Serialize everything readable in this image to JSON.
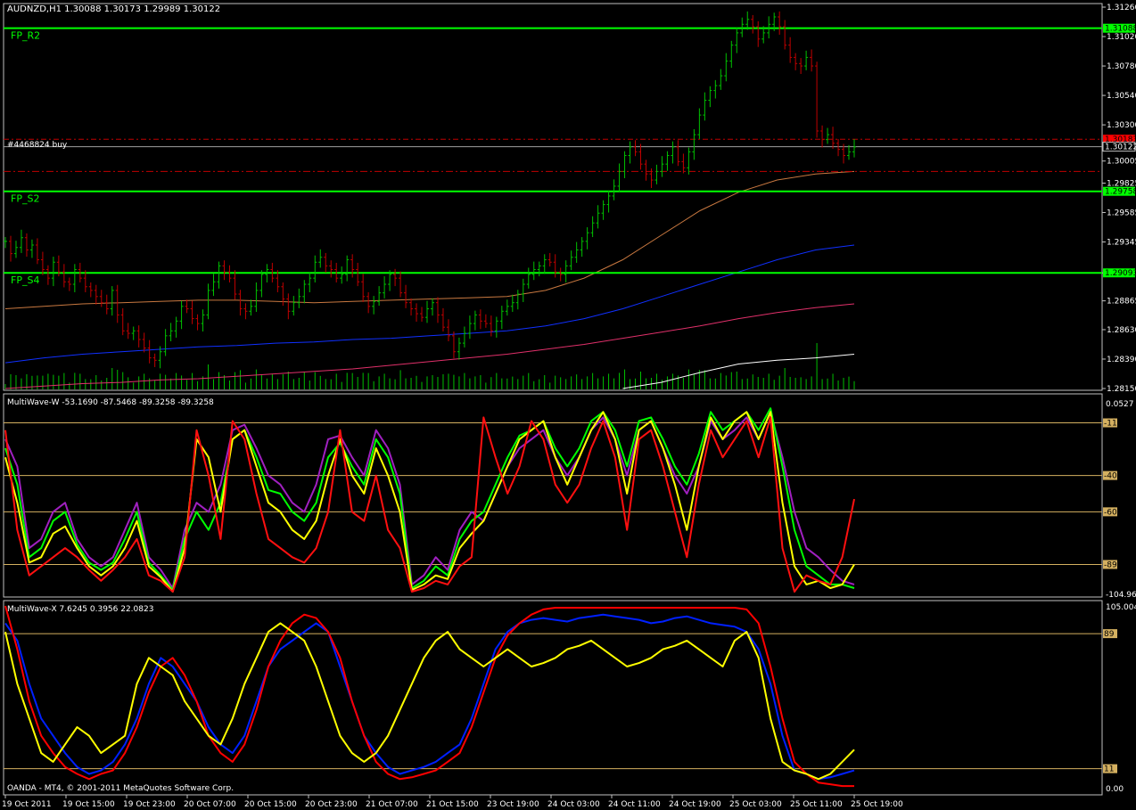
{
  "header": {
    "main_label": "AUDNZD,H1  1.30088 1.30173 1.29989 1.30122",
    "w_label": "MultiWave-W -53.1690 -87.5468 -89.3258 -89.3258",
    "x_label": "MultiWave-X 7.6245 0.3956 22.0823",
    "copyright": "OANDA - MT4, © 2001-2011 MetaQuotes Software Corp.",
    "order_label": "#4468824 buy"
  },
  "colors": {
    "background": "#000000",
    "grid": "#c0c0c0",
    "bull": "#00c000",
    "bear": "#c00000",
    "pivot": "#00ff00",
    "ma_orange": "#c87840",
    "ma_blue": "#1030ff",
    "ma_pink": "#e0306a",
    "ma_white": "#ffffff",
    "volume": "#00c000",
    "level": "#d4b060",
    "w_green": "#00ff00",
    "w_red": "#ff1010",
    "w_yellow": "#ffff00",
    "w_purple": "#a020c0",
    "x_blue": "#0020ff",
    "x_red": "#ff0000",
    "x_yellow": "#ffff00"
  },
  "chart_data": [
    {
      "type": "candlestick",
      "title": "AUDNZD,H1",
      "ylim": [
        1.2815,
        1.3126
      ],
      "y_ticks": [
        "1.31260",
        "1.31020",
        "1.30780",
        "1.30540",
        "1.30300",
        "1.30005",
        "1.29825",
        "1.29585",
        "1.29345",
        "1.29093",
        "1.28865",
        "1.28630",
        "1.28390",
        "1.28150"
      ],
      "y_tick_values": [
        1.3126,
        1.3102,
        1.3078,
        1.3054,
        1.303,
        1.30005,
        1.29825,
        1.29585,
        1.29345,
        1.29093,
        1.28865,
        1.2863,
        1.2839,
        1.2815
      ],
      "price_tags": [
        {
          "text": "1.31088",
          "value": 1.31088,
          "style": "pivot"
        },
        {
          "text": "1.30183",
          "value": 1.30183,
          "style": "order"
        },
        {
          "text": "1.30122",
          "value": 1.30122,
          "style": "current"
        },
        {
          "text": "1.29758",
          "value": 1.29758,
          "style": "pivot"
        },
        {
          "text": "1.29093",
          "value": 1.29093,
          "style": "pivot"
        }
      ],
      "pivots": [
        {
          "name": "FP_R2",
          "value": 1.31088
        },
        {
          "name": "FP_S2",
          "value": 1.29758
        },
        {
          "name": "FP_S4",
          "value": 1.29093
        }
      ],
      "order_line": 1.30183,
      "current_price": 1.30122,
      "stop_line": 1.2992,
      "closes": [
        1.2935,
        1.2925,
        1.293,
        1.2938,
        1.2928,
        1.2932,
        1.292,
        1.2912,
        1.2905,
        1.2918,
        1.291,
        1.2902,
        1.29,
        1.2912,
        1.2905,
        1.2898,
        1.2895,
        1.289,
        1.2885,
        1.288,
        1.2895,
        1.2875,
        1.2862,
        1.286,
        1.2862,
        1.2855,
        1.2848,
        1.284,
        1.2838,
        1.2845,
        1.2858,
        1.2862,
        1.287,
        1.2882,
        1.288,
        1.2872,
        1.2868,
        1.2875,
        1.2895,
        1.2902,
        1.2915,
        1.291,
        1.2905,
        1.2892,
        1.288,
        1.2878,
        1.2882,
        1.2895,
        1.2908,
        1.2912,
        1.2905,
        1.2898,
        1.2888,
        1.2878,
        1.2885,
        1.289,
        1.29,
        1.2905,
        1.2918,
        1.2922,
        1.2915,
        1.2912,
        1.2905,
        1.2908,
        1.292,
        1.2912,
        1.2902,
        1.289,
        1.2882,
        1.2886,
        1.2893,
        1.29,
        1.2908,
        1.2905,
        1.2893,
        1.2885,
        1.288,
        1.2876,
        1.2873,
        1.288,
        1.2885,
        1.2875,
        1.2865,
        1.2858,
        1.2845,
        1.2852,
        1.286,
        1.2868,
        1.2875,
        1.287,
        1.2868,
        1.2862,
        1.287,
        1.2878,
        1.2882,
        1.2885,
        1.2892,
        1.29,
        1.2908,
        1.2912,
        1.2915,
        1.292,
        1.2918,
        1.291,
        1.2908,
        1.2915,
        1.2922,
        1.2928,
        1.2935,
        1.2942,
        1.295,
        1.2958,
        1.2965,
        1.2972,
        1.298,
        1.2992,
        1.3005,
        1.3012,
        1.3008,
        1.2998,
        1.299,
        1.2985,
        1.2992,
        1.2998,
        1.3005,
        1.3012,
        1.3,
        1.2995,
        1.3008,
        1.3022,
        1.3038,
        1.305,
        1.3058,
        1.3062,
        1.307,
        1.3082,
        1.3095,
        1.3105,
        1.3112,
        1.3116,
        1.311,
        1.31,
        1.3105,
        1.3112,
        1.3118,
        1.311,
        1.3095,
        1.3085,
        1.308,
        1.3078,
        1.3085,
        1.3078,
        1.3025,
        1.3018,
        1.3022,
        1.3015,
        1.301,
        1.3005,
        1.3008,
        1.3012
      ],
      "moving_averages": [
        {
          "color": "ma_orange",
          "values": [
            1.288,
            1.2882,
            1.2884,
            1.2885,
            1.2886,
            1.2887,
            1.2887,
            1.2886,
            1.2885,
            1.2886,
            1.2887,
            1.2888,
            1.2889,
            1.289,
            1.2895,
            1.2905,
            1.292,
            1.294,
            1.296,
            1.2975,
            1.2985,
            1.299,
            1.2992
          ]
        },
        {
          "color": "ma_blue",
          "values": [
            1.2836,
            1.284,
            1.2843,
            1.2845,
            1.2847,
            1.2849,
            1.285,
            1.2852,
            1.2853,
            1.2855,
            1.2856,
            1.2858,
            1.286,
            1.2862,
            1.2866,
            1.2872,
            1.288,
            1.289,
            1.29,
            1.291,
            1.292,
            1.2928,
            1.2932
          ]
        },
        {
          "color": "ma_pink",
          "values": [
            1.2815,
            1.2817,
            1.2819,
            1.282,
            1.2822,
            1.2823,
            1.2825,
            1.2827,
            1.2829,
            1.2831,
            1.2834,
            1.2837,
            1.284,
            1.2843,
            1.2847,
            1.2851,
            1.2856,
            1.2861,
            1.2866,
            1.2872,
            1.2877,
            1.2881,
            1.2884
          ]
        },
        {
          "color": "ma_white",
          "values": [
            null,
            null,
            null,
            null,
            null,
            null,
            null,
            null,
            null,
            null,
            null,
            null,
            null,
            null,
            null,
            null,
            1.2815,
            1.282,
            1.2828,
            1.2835,
            1.2838,
            1.284,
            1.2843
          ]
        }
      ]
    },
    {
      "type": "line",
      "title": "MultiWave-W",
      "ylim": [
        -104.969,
        0.0527
      ],
      "y_ticks": [
        "0.0527",
        "-11",
        "-40",
        "-60",
        "-89",
        "-104.969"
      ],
      "y_tick_values": [
        0.0527,
        -11,
        -40,
        -60,
        -89,
        -104.969
      ],
      "levels": [
        -11,
        -40,
        -60,
        -89
      ],
      "series": [
        {
          "color": "w_purple",
          "values": [
            -20,
            -35,
            -80,
            -75,
            -60,
            -55,
            -75,
            -85,
            -90,
            -85,
            -70,
            -55,
            -85,
            -92,
            -102,
            -70,
            -55,
            -60,
            -45,
            -15,
            -12,
            -25,
            -40,
            -45,
            -55,
            -60,
            -45,
            -20,
            -18,
            -30,
            -40,
            -15,
            -25,
            -45,
            -100,
            -95,
            -85,
            -92,
            -70,
            -60,
            -65,
            -50,
            -35,
            -25,
            -20,
            -15,
            -30,
            -40,
            -30,
            -15,
            -8,
            -20,
            -40,
            -15,
            -10,
            -25,
            -40,
            -50,
            -35,
            -10,
            -20,
            -15,
            -8,
            -20,
            -5,
            -30,
            -60,
            -80,
            -85,
            -92,
            -98,
            -100
          ]
        },
        {
          "color": "w_green",
          "values": [
            -25,
            -45,
            -85,
            -80,
            -65,
            -60,
            -78,
            -88,
            -92,
            -88,
            -75,
            -60,
            -88,
            -95,
            -103,
            -75,
            -60,
            -70,
            -55,
            -20,
            -15,
            -30,
            -48,
            -50,
            -60,
            -65,
            -55,
            -30,
            -22,
            -35,
            -45,
            -20,
            -30,
            -50,
            -102,
            -98,
            -90,
            -95,
            -75,
            -65,
            -60,
            -45,
            -30,
            -18,
            -15,
            -10,
            -25,
            -35,
            -25,
            -10,
            -5,
            -15,
            -35,
            -10,
            -8,
            -20,
            -35,
            -45,
            -28,
            -5,
            -15,
            -10,
            -5,
            -15,
            -3,
            -35,
            -70,
            -90,
            -95,
            -100,
            -100,
            -102
          ]
        },
        {
          "color": "w_yellow",
          "values": [
            -30,
            -55,
            -88,
            -85,
            -72,
            -68,
            -80,
            -90,
            -95,
            -90,
            -80,
            -65,
            -90,
            -96,
            -104,
            -80,
            -20,
            -30,
            -60,
            -20,
            -15,
            -35,
            -55,
            -60,
            -70,
            -75,
            -65,
            -40,
            -20,
            -40,
            -50,
            -25,
            -40,
            -60,
            -103,
            -100,
            -95,
            -97,
            -80,
            -72,
            -65,
            -50,
            -35,
            -20,
            -15,
            -10,
            -30,
            -45,
            -30,
            -15,
            -5,
            -20,
            -50,
            -15,
            -10,
            -25,
            -45,
            -70,
            -35,
            -8,
            -20,
            -10,
            -5,
            -20,
            -5,
            -55,
            -90,
            -100,
            -98,
            -102,
            -100,
            -89
          ]
        },
        {
          "color": "w_red",
          "values": [
            -15,
            -70,
            -95,
            -90,
            -85,
            -80,
            -85,
            -92,
            -98,
            -92,
            -85,
            -75,
            -95,
            -98,
            -104,
            -85,
            -15,
            -40,
            -75,
            -10,
            -20,
            -50,
            -75,
            -80,
            -85,
            -88,
            -80,
            -60,
            -15,
            -60,
            -65,
            -40,
            -70,
            -80,
            -104,
            -102,
            -98,
            -100,
            -90,
            -85,
            -8,
            -30,
            -50,
            -35,
            -10,
            -20,
            -45,
            -55,
            -45,
            -25,
            -10,
            -30,
            -70,
            -20,
            -15,
            -35,
            -60,
            -85,
            -45,
            -15,
            -30,
            -20,
            -10,
            -30,
            -8,
            -80,
            -104,
            -95,
            -98,
            -100,
            -85,
            -53
          ]
        }
      ]
    },
    {
      "type": "line",
      "title": "MultiWave-X",
      "ylim": [
        0.0,
        105.004
      ],
      "y_ticks": [
        "105.004",
        "89",
        "11",
        "0.00"
      ],
      "y_tick_values": [
        105.004,
        89,
        11,
        0.0
      ],
      "levels": [
        89,
        11
      ],
      "series": [
        {
          "color": "x_blue",
          "values": [
            95,
            85,
            60,
            40,
            30,
            20,
            12,
            8,
            10,
            15,
            25,
            40,
            60,
            75,
            70,
            60,
            50,
            35,
            25,
            20,
            30,
            50,
            70,
            80,
            85,
            90,
            95,
            90,
            70,
            50,
            30,
            20,
            12,
            8,
            10,
            12,
            15,
            20,
            25,
            40,
            60,
            80,
            90,
            95,
            97,
            98,
            97,
            96,
            98,
            99,
            100,
            99,
            98,
            97,
            95,
            96,
            98,
            99,
            97,
            95,
            94,
            93,
            90,
            80,
            60,
            30,
            10,
            8,
            5,
            6,
            8,
            10
          ]
        },
        {
          "color": "x_red",
          "values": [
            105,
            80,
            50,
            30,
            20,
            12,
            8,
            5,
            8,
            10,
            20,
            35,
            55,
            70,
            75,
            65,
            50,
            30,
            20,
            15,
            25,
            45,
            70,
            85,
            95,
            100,
            98,
            90,
            75,
            50,
            30,
            15,
            8,
            5,
            6,
            8,
            10,
            15,
            20,
            35,
            55,
            75,
            88,
            95,
            100,
            103,
            104,
            104,
            104,
            104,
            104,
            104,
            104,
            104,
            104,
            104,
            104,
            104,
            104,
            104,
            104,
            104,
            103,
            95,
            70,
            40,
            15,
            8,
            3,
            2,
            1,
            1
          ]
        },
        {
          "color": "x_yellow",
          "values": [
            90,
            60,
            40,
            20,
            15,
            25,
            35,
            30,
            20,
            25,
            30,
            60,
            75,
            70,
            65,
            50,
            40,
            30,
            25,
            40,
            60,
            75,
            90,
            95,
            90,
            85,
            70,
            50,
            30,
            20,
            15,
            20,
            30,
            45,
            60,
            75,
            85,
            90,
            80,
            75,
            70,
            75,
            80,
            75,
            70,
            72,
            75,
            80,
            82,
            85,
            80,
            75,
            70,
            72,
            75,
            80,
            82,
            85,
            80,
            75,
            70,
            85,
            90,
            75,
            40,
            15,
            10,
            8,
            5,
            8,
            15,
            22
          ]
        }
      ]
    }
  ],
  "x_axis": {
    "labels": [
      "19 Oct 2011",
      "19 Oct 15:00",
      "19 Oct 23:00",
      "20 Oct 07:00",
      "20 Oct 15:00",
      "20 Oct 23:00",
      "21 Oct 07:00",
      "21 Oct 15:00",
      "23 Oct 19:00",
      "24 Oct 03:00",
      "24 Oct 11:00",
      "24 Oct 19:00",
      "25 Oct 03:00",
      "25 Oct 11:00",
      "25 Oct 19:00"
    ]
  }
}
